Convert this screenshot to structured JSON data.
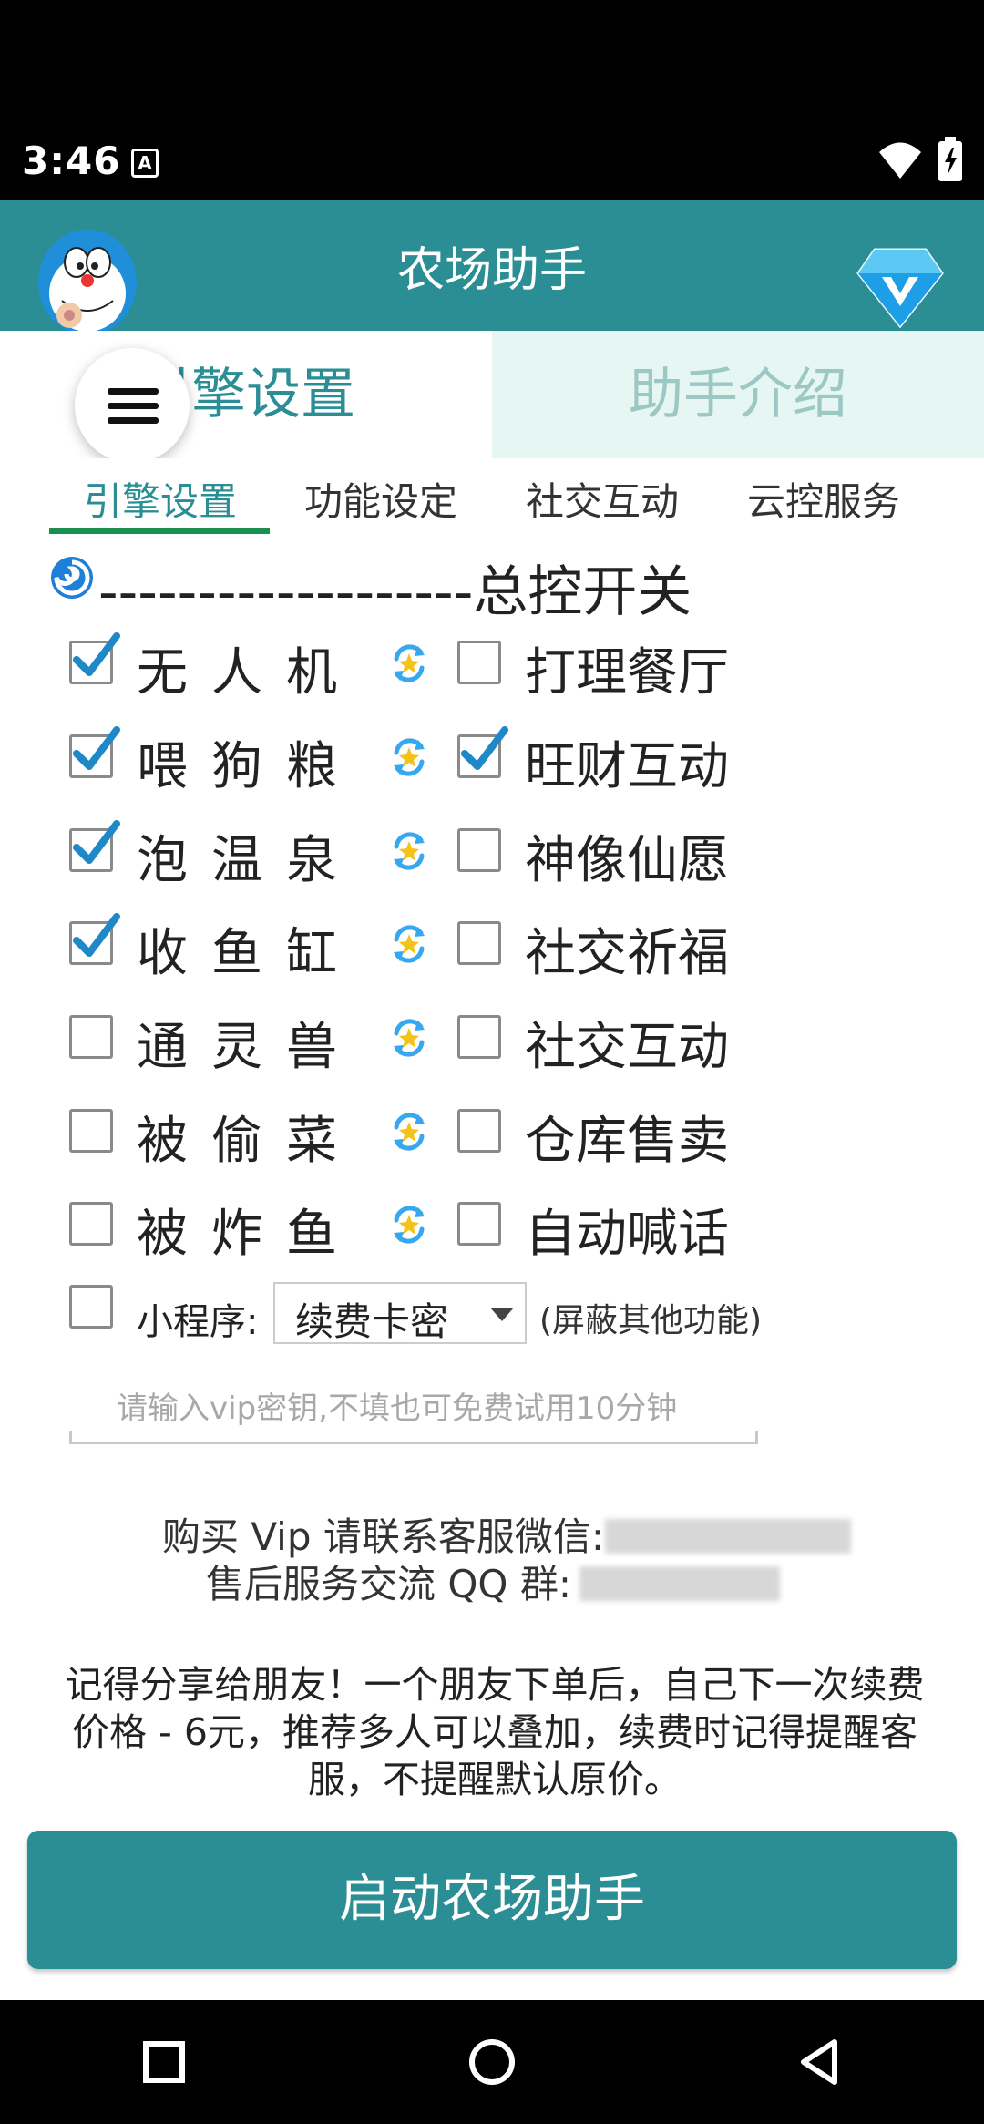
{
  "status_bar": {
    "time": "3:46",
    "notification_glyph": "A"
  },
  "header": {
    "title": "农场助手"
  },
  "top_tabs": [
    {
      "label": "引擎设置",
      "active": true
    },
    {
      "label": "助手介绍",
      "active": false
    }
  ],
  "sub_tabs": [
    {
      "label": "引擎设置",
      "active": true
    },
    {
      "label": "功能设定",
      "active": false
    },
    {
      "label": "社交互动",
      "active": false
    },
    {
      "label": "云控服务",
      "active": false
    }
  ],
  "master_switch": {
    "label": "-------------------总控开关"
  },
  "left_options": [
    {
      "label": "无人机",
      "checked": true
    },
    {
      "label": "喂狗粮",
      "checked": true
    },
    {
      "label": "泡温泉",
      "checked": true
    },
    {
      "label": "收鱼缸",
      "checked": true
    },
    {
      "label": "通灵兽",
      "checked": false
    },
    {
      "label": "被偷菜",
      "checked": false
    },
    {
      "label": "被炸鱼",
      "checked": false
    }
  ],
  "right_options": [
    {
      "label": "打理餐厅",
      "checked": false
    },
    {
      "label": "旺财互动",
      "checked": true
    },
    {
      "label": "神像仙愿",
      "checked": false
    },
    {
      "label": "社交祈福",
      "checked": false
    },
    {
      "label": "社交互动",
      "checked": false
    },
    {
      "label": "仓库售卖",
      "checked": false
    },
    {
      "label": "自动喊话",
      "checked": false
    }
  ],
  "mini_program": {
    "label": "小程序:",
    "selected": "续费卡密",
    "note": "(屏蔽其他功能)",
    "checked": false
  },
  "vip_input": {
    "placeholder": "请输入vip密钥,不填也可免费试用10分钟",
    "value": ""
  },
  "contact": {
    "wechat_label": "购买 Vip 请联系客服微信:",
    "qq_label": "售后服务交流 QQ 群:"
  },
  "share_text": "记得分享给朋友！一个朋友下单后，自己下一次续费价格 - 6元，推荐多人可以叠加，续费时记得提醒客服，不提醒默认原价。",
  "start_button": {
    "label": "启动农场助手"
  },
  "colors": {
    "primary": "#2a8e94",
    "underline": "#1a8f4f",
    "checkbox_check": "#1e88c8",
    "inactive_tab_bg": "#e6f6f3"
  }
}
